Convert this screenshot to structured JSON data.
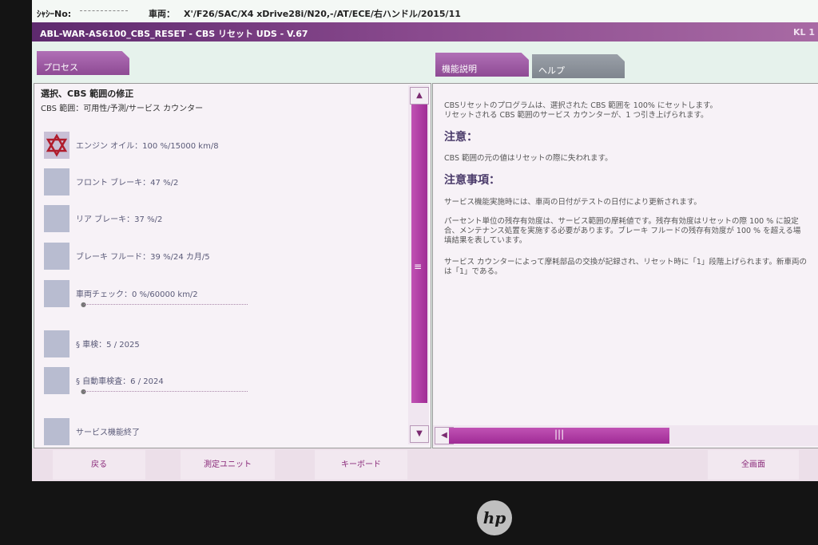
{
  "header": {
    "chassis_label": "ｼｬｼｰNo:",
    "vehicle_label": "車両：",
    "vehicle_value": "X'/F26/SAC/X4 xDrive28i/N20,-/AT/ECE/右ハンドル/2015/11"
  },
  "title": {
    "text": "ABL-WAR-AS6100_CBS_RESET - CBS リセット UDS - V.67",
    "right": "KL 1"
  },
  "tabs": {
    "process": "プロセス",
    "description": "機能説明",
    "help": "ヘルプ"
  },
  "left": {
    "title": "選択、CBS 範囲の修正",
    "subtitle": "CBS 範囲：可用性/予測/サービス カウンター",
    "items": [
      {
        "label": "エンジン オイル：100 %/15000 km/8",
        "icon": "star-of-david-icon",
        "active": true
      },
      {
        "label": "フロント ブレーキ：47 %/2"
      },
      {
        "label": "リア ブレーキ：37 %/2"
      },
      {
        "label": "ブレーキ フルード：39 %/24 カ月/5"
      },
      {
        "label": "車両チェック：0 %/60000 km/2"
      },
      {
        "label": "§ 車検：5 / 2025"
      },
      {
        "label": "§ 自動車検査：6 / 2024"
      },
      {
        "label": "サービス機能終了"
      }
    ]
  },
  "right": {
    "intro1": "CBSリセットのプログラムは、選択された CBS 範囲を 100% にセットします。",
    "intro2": "リセットされる CBS 範囲のサービス カウンターが、1 つ引き上げられます。",
    "head1": "注意：",
    "note1": "CBS 範囲の元の値はリセットの際に失われます。",
    "head2": "注意事項：",
    "p1": "サービス機能実施時には、車両の日付がテストの日付により更新されます。",
    "p2a": "パーセント単位の残存有効度は、サービス範囲の摩耗値です。残存有効度はリセットの際 100 % に設定",
    "p2b": "合、メンテナンス処置を実施する必要があります。ブレーキ フルードの残存有効度が 100 % を超える場",
    "p2c": "填結果を表しています。",
    "p3a": "サービス カウンターによって摩耗部品の交換が記録され、リセット時に「1」段階上げられます。新車両の",
    "p3b": "は「1」である。"
  },
  "buttons": {
    "back": "戻る",
    "measure": "測定ユニット",
    "keyboard": "キーボード",
    "fullscreen": "全画面"
  },
  "brand": "hp",
  "colors": {
    "accent": "#a02c96",
    "title_bar": "#5e2a6e",
    "star": "#b01c2c"
  }
}
